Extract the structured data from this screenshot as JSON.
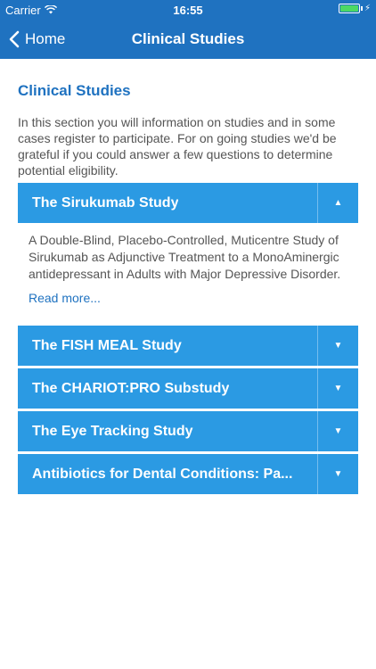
{
  "status_bar": {
    "carrier": "Carrier",
    "time": "16:55",
    "wifi_icon": "wifi-icon",
    "battery_icon": "battery-icon",
    "battery_color": "#4cd964"
  },
  "nav": {
    "back_label": "Home",
    "title": "Clinical Studies",
    "bar_color": "#1f72c0"
  },
  "page": {
    "section_title": "Clinical Studies",
    "intro": "In this section you will information on studies and in some cases register to participate. For on going studies we'd be grateful if you could answer a few questions to determine potential eligibility."
  },
  "studies": [
    {
      "title": "The Sirukumab Study",
      "expanded": true,
      "toggle_icon": "chevron-up-icon",
      "description": "A Double-Blind, Placebo-Controlled, Muticentre Study of Sirukumab as Adjunctive Treatment to a MonoAminergic antidepressant in Adults with Major Depressive Disorder.",
      "read_more": "Read more..."
    },
    {
      "title": "The FISH MEAL Study",
      "expanded": false,
      "toggle_icon": "chevron-down-icon"
    },
    {
      "title": "The CHARIOT:PRO Substudy",
      "expanded": false,
      "toggle_icon": "chevron-down-icon"
    },
    {
      "title": "The Eye Tracking Study",
      "expanded": false,
      "toggle_icon": "chevron-down-icon"
    },
    {
      "title": "Antibiotics for Dental Conditions: Pa...",
      "expanded": false,
      "toggle_icon": "chevron-down-icon"
    }
  ],
  "accent_color": "#2b9ae3"
}
